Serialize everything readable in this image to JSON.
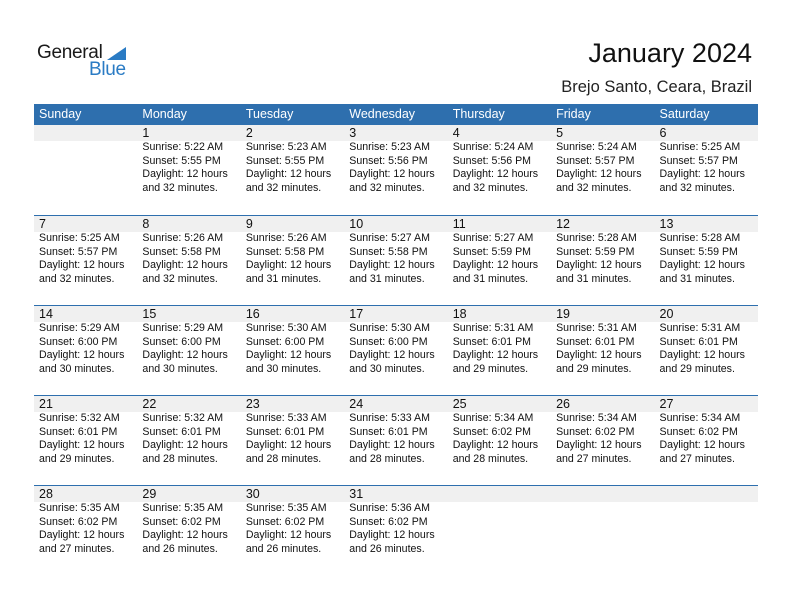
{
  "logo": {
    "general": "General",
    "blue": "Blue",
    "icon": "triangle-flag-icon"
  },
  "header": {
    "title": "January 2024",
    "subtitle": "Brejo Santo, Ceara, Brazil"
  },
  "colors": {
    "accent": "#2e6fae",
    "band": "#f0f0f0",
    "logo_blue": "#2a7bc4"
  },
  "weekdays": [
    "Sunday",
    "Monday",
    "Tuesday",
    "Wednesday",
    "Thursday",
    "Friday",
    "Saturday"
  ],
  "weeks": [
    [
      null,
      {
        "day": "1",
        "sunrise": "Sunrise: 5:22 AM",
        "sunset": "Sunset: 5:55 PM",
        "daylight1": "Daylight: 12 hours",
        "daylight2": "and 32 minutes."
      },
      {
        "day": "2",
        "sunrise": "Sunrise: 5:23 AM",
        "sunset": "Sunset: 5:55 PM",
        "daylight1": "Daylight: 12 hours",
        "daylight2": "and 32 minutes."
      },
      {
        "day": "3",
        "sunrise": "Sunrise: 5:23 AM",
        "sunset": "Sunset: 5:56 PM",
        "daylight1": "Daylight: 12 hours",
        "daylight2": "and 32 minutes."
      },
      {
        "day": "4",
        "sunrise": "Sunrise: 5:24 AM",
        "sunset": "Sunset: 5:56 PM",
        "daylight1": "Daylight: 12 hours",
        "daylight2": "and 32 minutes."
      },
      {
        "day": "5",
        "sunrise": "Sunrise: 5:24 AM",
        "sunset": "Sunset: 5:57 PM",
        "daylight1": "Daylight: 12 hours",
        "daylight2": "and 32 minutes."
      },
      {
        "day": "6",
        "sunrise": "Sunrise: 5:25 AM",
        "sunset": "Sunset: 5:57 PM",
        "daylight1": "Daylight: 12 hours",
        "daylight2": "and 32 minutes."
      }
    ],
    [
      {
        "day": "7",
        "sunrise": "Sunrise: 5:25 AM",
        "sunset": "Sunset: 5:57 PM",
        "daylight1": "Daylight: 12 hours",
        "daylight2": "and 32 minutes."
      },
      {
        "day": "8",
        "sunrise": "Sunrise: 5:26 AM",
        "sunset": "Sunset: 5:58 PM",
        "daylight1": "Daylight: 12 hours",
        "daylight2": "and 32 minutes."
      },
      {
        "day": "9",
        "sunrise": "Sunrise: 5:26 AM",
        "sunset": "Sunset: 5:58 PM",
        "daylight1": "Daylight: 12 hours",
        "daylight2": "and 31 minutes."
      },
      {
        "day": "10",
        "sunrise": "Sunrise: 5:27 AM",
        "sunset": "Sunset: 5:58 PM",
        "daylight1": "Daylight: 12 hours",
        "daylight2": "and 31 minutes."
      },
      {
        "day": "11",
        "sunrise": "Sunrise: 5:27 AM",
        "sunset": "Sunset: 5:59 PM",
        "daylight1": "Daylight: 12 hours",
        "daylight2": "and 31 minutes."
      },
      {
        "day": "12",
        "sunrise": "Sunrise: 5:28 AM",
        "sunset": "Sunset: 5:59 PM",
        "daylight1": "Daylight: 12 hours",
        "daylight2": "and 31 minutes."
      },
      {
        "day": "13",
        "sunrise": "Sunrise: 5:28 AM",
        "sunset": "Sunset: 5:59 PM",
        "daylight1": "Daylight: 12 hours",
        "daylight2": "and 31 minutes."
      }
    ],
    [
      {
        "day": "14",
        "sunrise": "Sunrise: 5:29 AM",
        "sunset": "Sunset: 6:00 PM",
        "daylight1": "Daylight: 12 hours",
        "daylight2": "and 30 minutes."
      },
      {
        "day": "15",
        "sunrise": "Sunrise: 5:29 AM",
        "sunset": "Sunset: 6:00 PM",
        "daylight1": "Daylight: 12 hours",
        "daylight2": "and 30 minutes."
      },
      {
        "day": "16",
        "sunrise": "Sunrise: 5:30 AM",
        "sunset": "Sunset: 6:00 PM",
        "daylight1": "Daylight: 12 hours",
        "daylight2": "and 30 minutes."
      },
      {
        "day": "17",
        "sunrise": "Sunrise: 5:30 AM",
        "sunset": "Sunset: 6:00 PM",
        "daylight1": "Daylight: 12 hours",
        "daylight2": "and 30 minutes."
      },
      {
        "day": "18",
        "sunrise": "Sunrise: 5:31 AM",
        "sunset": "Sunset: 6:01 PM",
        "daylight1": "Daylight: 12 hours",
        "daylight2": "and 29 minutes."
      },
      {
        "day": "19",
        "sunrise": "Sunrise: 5:31 AM",
        "sunset": "Sunset: 6:01 PM",
        "daylight1": "Daylight: 12 hours",
        "daylight2": "and 29 minutes."
      },
      {
        "day": "20",
        "sunrise": "Sunrise: 5:31 AM",
        "sunset": "Sunset: 6:01 PM",
        "daylight1": "Daylight: 12 hours",
        "daylight2": "and 29 minutes."
      }
    ],
    [
      {
        "day": "21",
        "sunrise": "Sunrise: 5:32 AM",
        "sunset": "Sunset: 6:01 PM",
        "daylight1": "Daylight: 12 hours",
        "daylight2": "and 29 minutes."
      },
      {
        "day": "22",
        "sunrise": "Sunrise: 5:32 AM",
        "sunset": "Sunset: 6:01 PM",
        "daylight1": "Daylight: 12 hours",
        "daylight2": "and 28 minutes."
      },
      {
        "day": "23",
        "sunrise": "Sunrise: 5:33 AM",
        "sunset": "Sunset: 6:01 PM",
        "daylight1": "Daylight: 12 hours",
        "daylight2": "and 28 minutes."
      },
      {
        "day": "24",
        "sunrise": "Sunrise: 5:33 AM",
        "sunset": "Sunset: 6:01 PM",
        "daylight1": "Daylight: 12 hours",
        "daylight2": "and 28 minutes."
      },
      {
        "day": "25",
        "sunrise": "Sunrise: 5:34 AM",
        "sunset": "Sunset: 6:02 PM",
        "daylight1": "Daylight: 12 hours",
        "daylight2": "and 28 minutes."
      },
      {
        "day": "26",
        "sunrise": "Sunrise: 5:34 AM",
        "sunset": "Sunset: 6:02 PM",
        "daylight1": "Daylight: 12 hours",
        "daylight2": "and 27 minutes."
      },
      {
        "day": "27",
        "sunrise": "Sunrise: 5:34 AM",
        "sunset": "Sunset: 6:02 PM",
        "daylight1": "Daylight: 12 hours",
        "daylight2": "and 27 minutes."
      }
    ],
    [
      {
        "day": "28",
        "sunrise": "Sunrise: 5:35 AM",
        "sunset": "Sunset: 6:02 PM",
        "daylight1": "Daylight: 12 hours",
        "daylight2": "and 27 minutes."
      },
      {
        "day": "29",
        "sunrise": "Sunrise: 5:35 AM",
        "sunset": "Sunset: 6:02 PM",
        "daylight1": "Daylight: 12 hours",
        "daylight2": "and 26 minutes."
      },
      {
        "day": "30",
        "sunrise": "Sunrise: 5:35 AM",
        "sunset": "Sunset: 6:02 PM",
        "daylight1": "Daylight: 12 hours",
        "daylight2": "and 26 minutes."
      },
      {
        "day": "31",
        "sunrise": "Sunrise: 5:36 AM",
        "sunset": "Sunset: 6:02 PM",
        "daylight1": "Daylight: 12 hours",
        "daylight2": "and 26 minutes."
      },
      null,
      null,
      null
    ]
  ]
}
